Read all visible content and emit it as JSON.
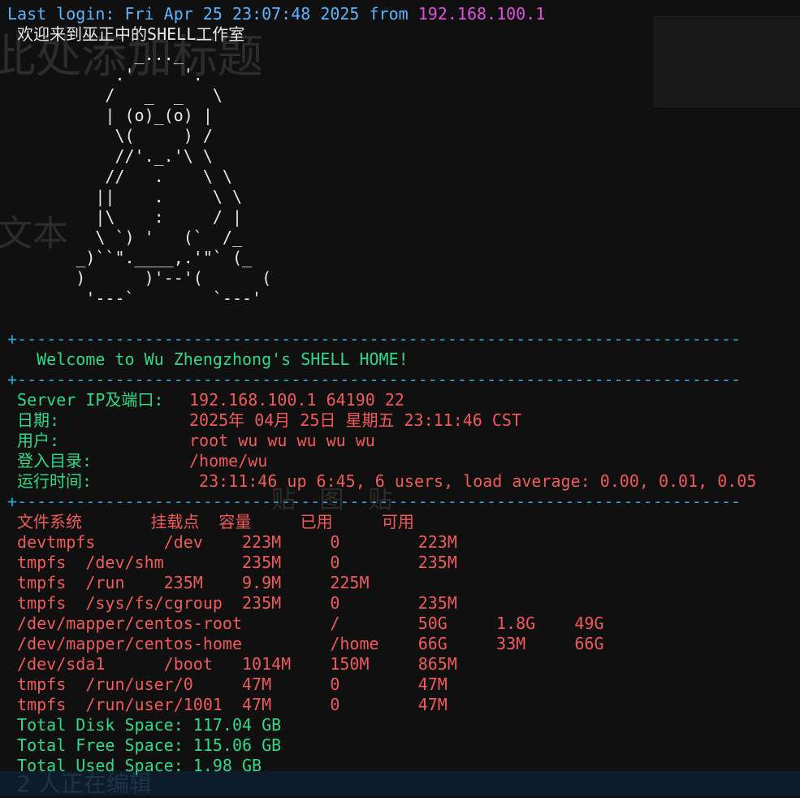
{
  "ghost": {
    "heading": "此处添加标题",
    "body": "文本",
    "icons": "贴 图 贴",
    "footer": "2 人正在编辑"
  },
  "login": {
    "label": "Last login: Fri Apr 25 23:07:48 2025 from ",
    "ip": "192.168.100.1"
  },
  "motd": " 欢迎来到巫正中的SHELL工作室",
  "art": [
    "             _..._",
    "           .'     '.",
    "          /   _  _   \\",
    "          | (o)_(o) |",
    "           \\(     ) /",
    "           //'._.'\\ \\",
    "          //   .    \\ \\",
    "         ||    .     \\ \\",
    "         |\\    :     / |",
    "         \\ `) '   (`  /_",
    "       _)``\".____,.'\"` (_",
    "       )      )'--'(      (",
    "        '---`        `---'"
  ],
  "rule": "+--------------------------------------------------------------------------",
  "welcome": "   Welcome to Wu Zhengzhong's SHELL HOME!",
  "info": [
    {
      "key": " Server IP及端口:",
      "value": "192.168.100.1 64190 22"
    },
    {
      "key": " 日期:",
      "value": "2025年 04月 25日 星期五 23:11:46 CST"
    },
    {
      "key": " 用户:",
      "value": "root wu wu wu wu wu"
    },
    {
      "key": " 登入目录:",
      "value": "/home/wu"
    },
    {
      "key": " 运行时间:",
      "value": " 23:11:46 up 6:45, 6 users, load average: 0.00, 0.01, 0.05"
    }
  ],
  "df": {
    "header": " 文件系统       挂载点  容量     已用     可用",
    "rows": [
      " devtmpfs       /dev    223M     0        223M",
      " tmpfs  /dev/shm        235M     0        235M",
      " tmpfs  /run    235M    9.9M     225M",
      " tmpfs  /sys/fs/cgroup  235M     0        235M",
      " /dev/mapper/centos-root         /        50G     1.8G    49G",
      " /dev/mapper/centos-home         /home    66G     33M     66G",
      " /dev/sda1      /boot   1014M    150M     865M",
      " tmpfs  /run/user/0     47M      0        47M",
      " tmpfs  /run/user/1001  47M      0        47M"
    ]
  },
  "totals": [
    " Total Disk Space: 117.04 GB",
    " Total Free Space: 115.06 GB",
    " Total Used Space: 1.98 GB"
  ],
  "colors": {
    "background": "#101010",
    "login_label": "#5ab4ff",
    "login_ip": "#e050e0",
    "welcome": "#2fd98a",
    "key": "#2fd98a",
    "value": "#f05a5a",
    "rule": "#2aa6d6"
  }
}
